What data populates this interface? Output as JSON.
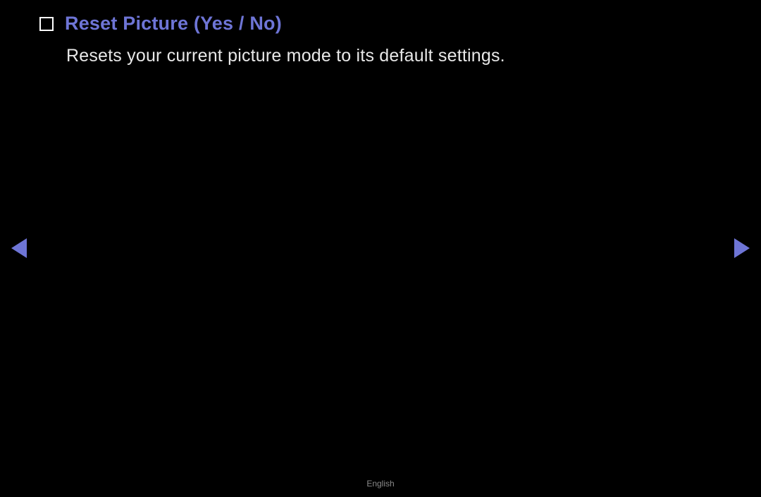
{
  "heading": "Reset Picture (Yes / No)",
  "description": "Resets your current picture mode to its default settings.",
  "footer": "English",
  "colors": {
    "heading": "#6e75d6",
    "arrow": "#6e75d6"
  }
}
